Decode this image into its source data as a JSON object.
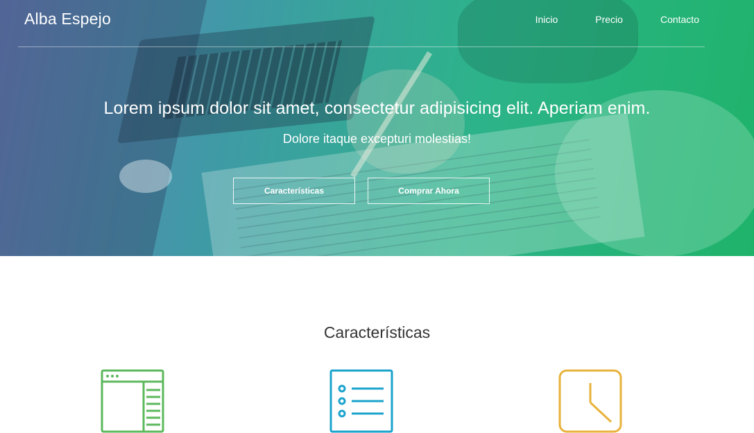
{
  "nav": {
    "brand": "Alba Espejo",
    "links": [
      "Inicio",
      "Precio",
      "Contacto"
    ]
  },
  "hero": {
    "headline": "Lorem ipsum dolor sit amet, consectetur adipisicing elit. Aperiam enim.",
    "subline": "Dolore itaque excepturi molestias!",
    "buttons": {
      "features": "Características",
      "buy": "Comprar Ahora"
    }
  },
  "features": {
    "title": "Características",
    "icons": [
      "browser-window-icon",
      "list-icon",
      "clock-icon"
    ]
  },
  "colors": {
    "gradient_start": "#6a7fb8",
    "gradient_end": "#1fb36a",
    "icon_green": "#5cb85c",
    "icon_blue": "#1aa3cc",
    "icon_yellow": "#e8b23a"
  }
}
